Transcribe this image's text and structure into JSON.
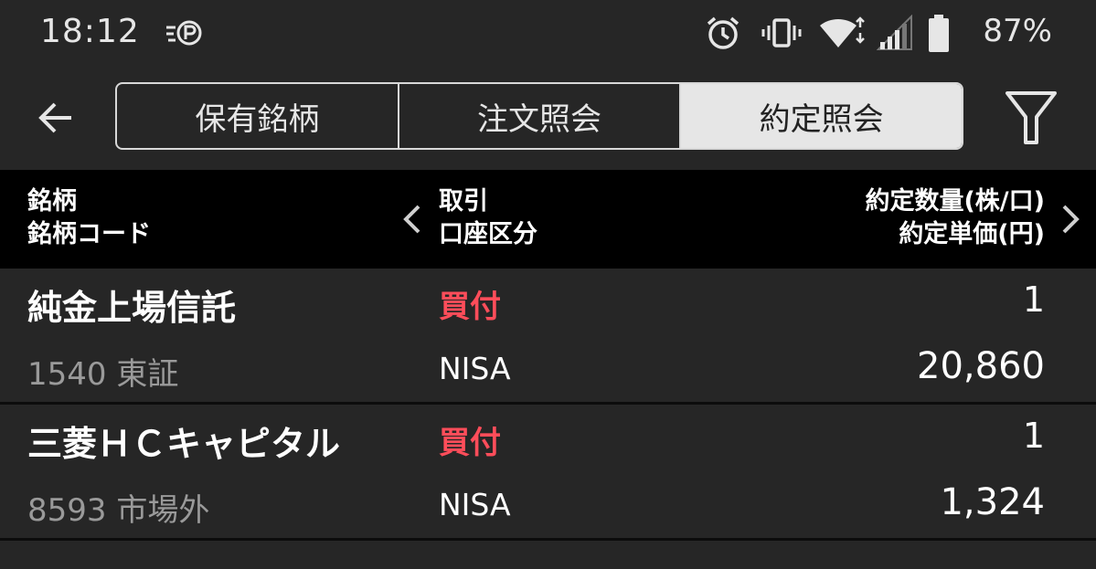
{
  "status_bar": {
    "time": "18:12",
    "battery": "87%",
    "icons": [
      "p-icon",
      "alarm-icon",
      "vibrate-icon",
      "wifi-icon",
      "signal-icon",
      "battery-icon"
    ]
  },
  "toolbar": {
    "tabs": [
      {
        "label": "保有銘柄",
        "active": false
      },
      {
        "label": "注文照会",
        "active": false
      },
      {
        "label": "約定照会",
        "active": true
      }
    ]
  },
  "header": {
    "col1_line1": "銘柄",
    "col1_line2": "銘柄コード",
    "col2_line1": "取引",
    "col2_line2": "口座区分",
    "col3_line1": "約定数量(株/口)",
    "col3_line2": "約定単価(円)"
  },
  "rows": [
    {
      "name": "純金上場信託",
      "code": "1540  東証",
      "trade": "買付",
      "account": "NISA",
      "qty": "1",
      "price": "20,860"
    },
    {
      "name": "三菱ＨＣキャピタル",
      "code": "8593  市場外",
      "trade": "買付",
      "account": "NISA",
      "qty": "1",
      "price": "1,324"
    }
  ],
  "colors": {
    "background": "#262626",
    "header_bg": "#000000",
    "buy": "#ff4d5a",
    "active_tab_bg": "#e6e6e6"
  }
}
